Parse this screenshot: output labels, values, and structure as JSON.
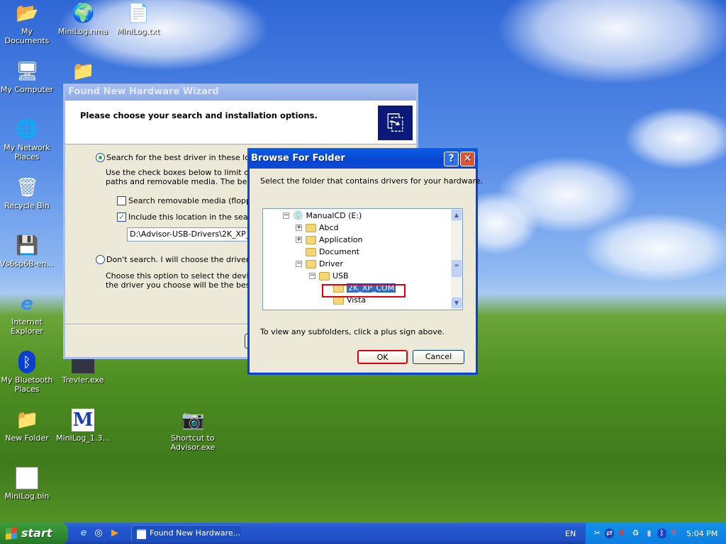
{
  "desktop": {
    "icons": [
      {
        "label": "My Documents",
        "icon": "my-documents-icon"
      },
      {
        "label": "MiniLog.nma",
        "icon": "globe-icon"
      },
      {
        "label": "MiniLog.txt",
        "icon": "text-file-icon"
      },
      {
        "label": "My Computer",
        "icon": "my-computer-icon"
      },
      {
        "label": "",
        "icon": "folder-icon"
      },
      {
        "label": "My Network Places",
        "icon": "network-icon"
      },
      {
        "label": "Recycle Bin",
        "icon": "recycle-bin-icon"
      },
      {
        "label": "Vs6sp6B-en...",
        "icon": "installer-icon"
      },
      {
        "label": "Internet Explorer",
        "icon": "ie-icon"
      },
      {
        "label": "My Bluetooth Places",
        "icon": "bluetooth-icon"
      },
      {
        "label": "Trevler.exe",
        "icon": "exe-icon"
      },
      {
        "label": "New Folder",
        "icon": "folder-icon"
      },
      {
        "label": "MiniLog_1.3...",
        "icon": "minilog-icon"
      },
      {
        "label": "Shortcut to Advisor.exe",
        "icon": "camera-icon"
      },
      {
        "label": "MiniLog.bin",
        "icon": "bin-file-icon"
      }
    ]
  },
  "wizard": {
    "title": "Found New Hardware Wizard",
    "heading": "Please choose your search and installation options.",
    "option1": "Search for the best driver in these locations.",
    "option1_desc1": "Use the check boxes below to limit or expand the default search, which includes local",
    "option1_desc2": "paths and removable media. The best driver found will be installed.",
    "check1": "Search removable media (floppy, CD-ROM...)",
    "check1_checked": false,
    "check2": "Include this location in the search:",
    "check2_checked": true,
    "path": "D:\\Advisor-USB-Drivers\\2K_XP_COM",
    "option2": "Don't search. I will choose the driver to install.",
    "option2_desc1": "Choose this option to select the device driver from a list. Windows does not guarantee that",
    "option2_desc2": "the driver you choose will be the best match for your hardware.",
    "selected_option": 1
  },
  "browse": {
    "title": "Browse For Folder",
    "help": "?",
    "close": "✕",
    "instruction": "Select the folder that contains drivers for your hardware.",
    "tree": [
      {
        "label": "ManualCD (E:)",
        "expander": "−",
        "kind": "drive"
      },
      {
        "label": "Abcd",
        "expander": "+",
        "kind": "folder"
      },
      {
        "label": "Application",
        "expander": "+",
        "kind": "folder"
      },
      {
        "label": "Document",
        "expander": "",
        "kind": "folder"
      },
      {
        "label": "Driver",
        "expander": "−",
        "kind": "folder"
      },
      {
        "label": "USB",
        "expander": "−",
        "kind": "folder"
      },
      {
        "label": "2K_XP_COM",
        "expander": "",
        "kind": "folder",
        "selected": true
      },
      {
        "label": "Vista",
        "expander": "",
        "kind": "folder"
      }
    ],
    "hint": "To view any subfolders, click a plus sign above.",
    "ok": "OK",
    "cancel": "Cancel",
    "highlight_color": "#e00010"
  },
  "taskbar": {
    "start": "start",
    "task": "Found New Hardware...",
    "lang": "EN",
    "clock": "5:04 PM"
  }
}
